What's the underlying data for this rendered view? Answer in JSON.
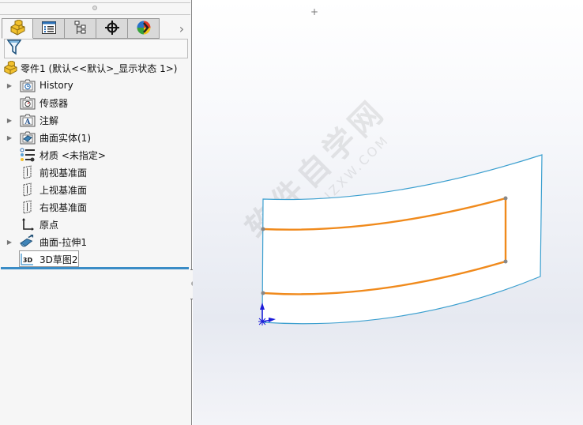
{
  "feature_manager": {
    "tabs": [
      {
        "name": "featuremanager-tab",
        "icon": "part-icon",
        "active": true
      },
      {
        "name": "propertymanager-tab",
        "icon": "property-list-icon",
        "active": false
      },
      {
        "name": "configurationmanager-tab",
        "icon": "configuration-tree-icon",
        "active": false
      },
      {
        "name": "dimxpert-tab",
        "icon": "crosshair-icon",
        "active": false
      },
      {
        "name": "display-manager-tab",
        "icon": "appearance-sphere-icon",
        "active": false
      }
    ],
    "more_tabs_glyph": "›",
    "filter_icon": "filter-icon",
    "root": {
      "label": "零件1  (默认<<默认>_显示状态 1>)",
      "icon": "part-icon"
    },
    "tree": [
      {
        "label": "History",
        "icon": "history-folder-icon",
        "expandable": true
      },
      {
        "label": "传感器",
        "icon": "sensor-folder-icon",
        "expandable": false
      },
      {
        "label": "注解",
        "icon": "annotation-folder-icon",
        "expandable": true
      },
      {
        "label": "曲面实体(1)",
        "icon": "surface-bodies-folder-icon",
        "expandable": true
      },
      {
        "label": "材质 <未指定>",
        "icon": "material-icon",
        "expandable": false
      },
      {
        "label": "前视基准面",
        "icon": "plane-icon",
        "expandable": false
      },
      {
        "label": "上视基准面",
        "icon": "plane-icon",
        "expandable": false
      },
      {
        "label": "右视基准面",
        "icon": "plane-icon",
        "expandable": false
      },
      {
        "label": "原点",
        "icon": "origin-icon",
        "expandable": false
      },
      {
        "label": "曲面-拉伸1",
        "icon": "surface-extrude-icon",
        "expandable": true
      },
      {
        "label": "3D草图2",
        "icon": "3d-sketch-icon",
        "expandable": false,
        "selected": true
      }
    ],
    "sketch_icon_text": "3D"
  },
  "viewport": {
    "cursor_glyph": "+",
    "watermark": {
      "line1": "软件自学网",
      "line2": "WWW.RJZXW.COM"
    },
    "colors": {
      "surface_edge": "#3b9fcf",
      "sketch": "#f08a1c",
      "sketch_point": "#888888",
      "triad": "#1b1bd9",
      "rollback_bar": "#3a8cc6"
    }
  }
}
